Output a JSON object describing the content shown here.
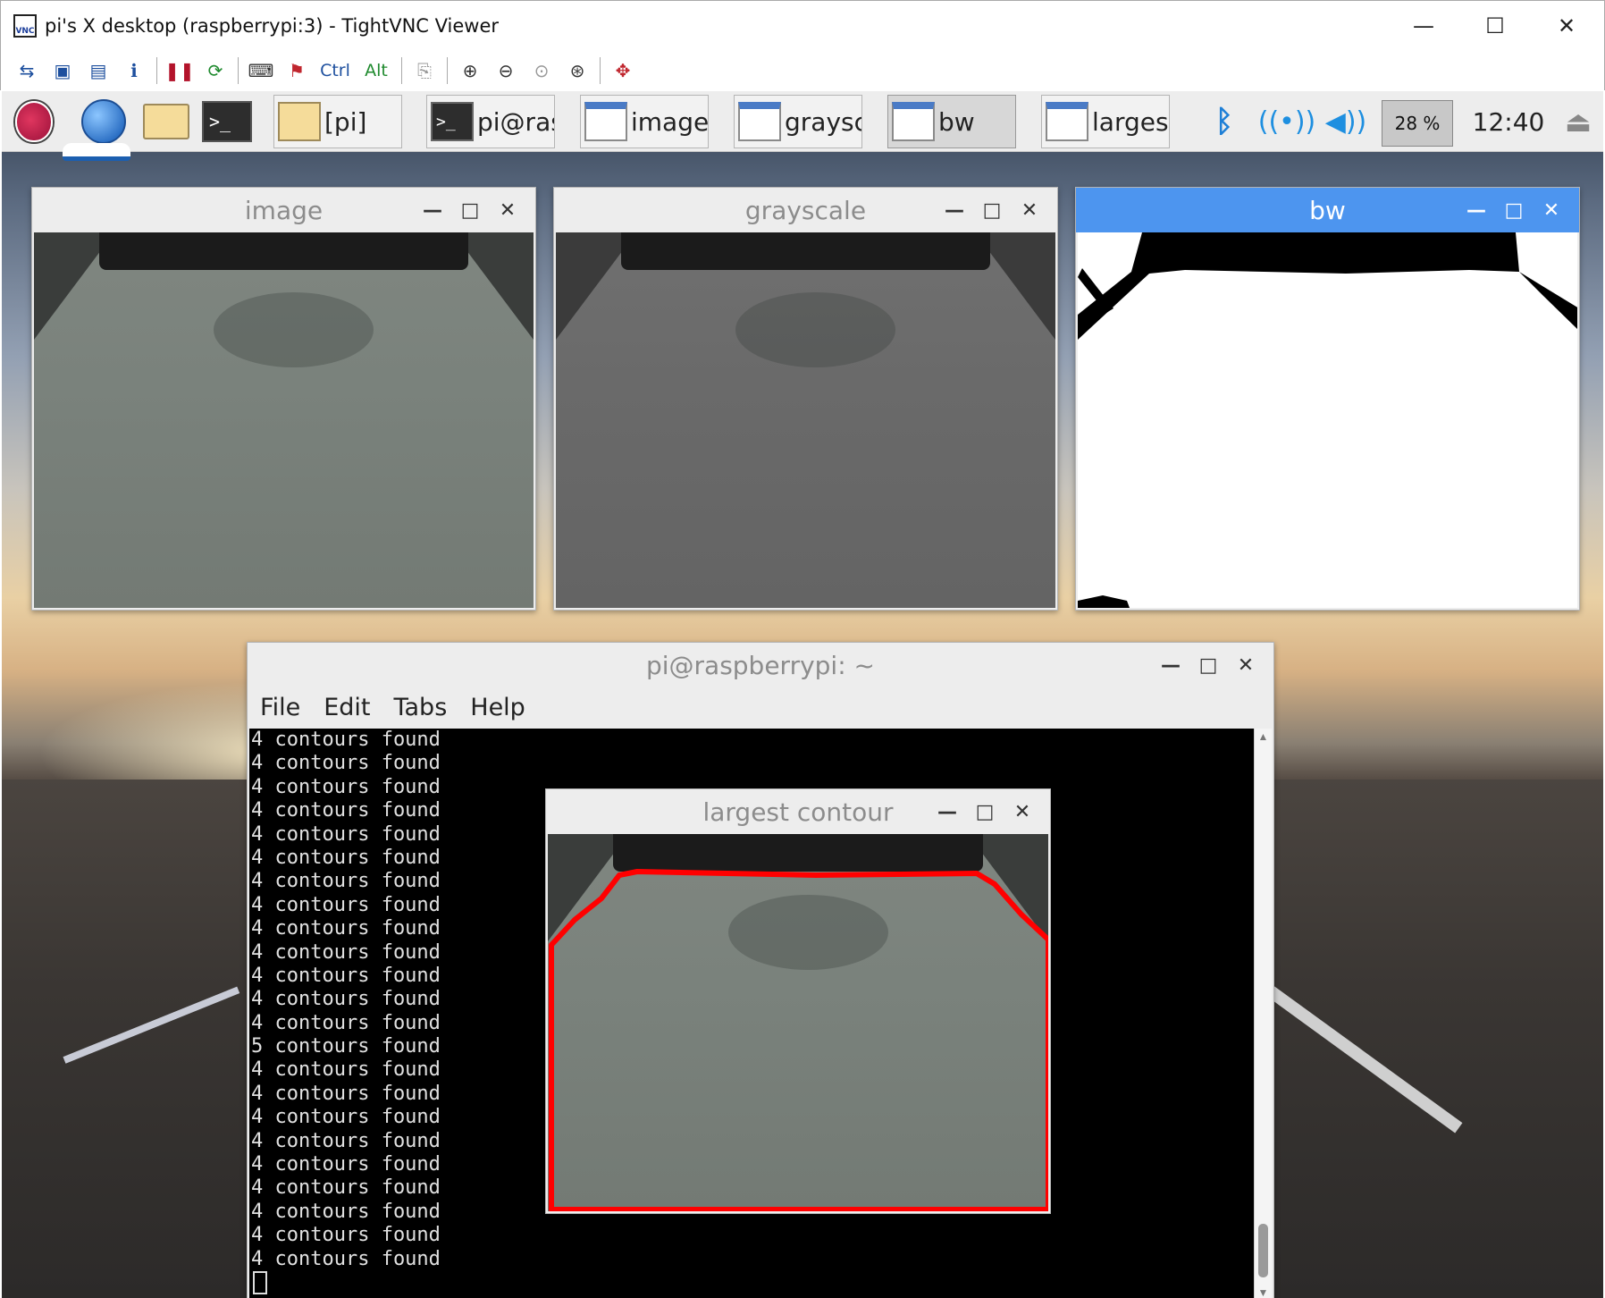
{
  "vnc": {
    "title": "pi's X desktop (raspberrypi:3) - TightVNC Viewer",
    "icon_text": "VNC",
    "controls": {
      "minimize": "—",
      "maximize": "☐",
      "close": "✕"
    },
    "toolbar": {
      "ctrl_label": "Ctrl",
      "alt_label": "Alt",
      "icons": [
        "new-connection-icon",
        "save-icon",
        "options-icon",
        "info-icon",
        "pause-icon",
        "refresh-icon",
        "send-ctrl-alt-del-icon",
        "ctrl-esc-icon",
        "ctrl-key-icon",
        "alt-key-icon",
        "clipboard-icon",
        "zoom-in-icon",
        "zoom-out-icon",
        "zoom-100-icon",
        "zoom-auto-icon",
        "fullscreen-icon"
      ]
    }
  },
  "panel": {
    "tasks": [
      {
        "label": "[pi]",
        "icon": "folder-icon"
      },
      {
        "label": "pi@ras...",
        "icon": "terminal-icon"
      },
      {
        "label": "image",
        "icon": "window-icon"
      },
      {
        "label": "graysc...",
        "icon": "window-icon"
      },
      {
        "label": "bw",
        "icon": "window-icon",
        "active": true
      },
      {
        "label": "largest...",
        "icon": "window-icon"
      }
    ],
    "tray": {
      "bluetooth": "ᛒ",
      "wifi": "((•))",
      "volume": "◀))",
      "cpu": "28 %",
      "clock": "12:40",
      "eject": "⏏"
    }
  },
  "windows": {
    "image": {
      "title": "image"
    },
    "grayscale": {
      "title": "grayscale"
    },
    "bw": {
      "title": "bw"
    },
    "largest": {
      "title": "largest contour"
    },
    "terminal": {
      "title": "pi@raspberrypi: ~",
      "menu": [
        "File",
        "Edit",
        "Tabs",
        "Help"
      ],
      "lines": [
        "4 contours found",
        "4 contours found",
        "4 contours found",
        "4 contours found",
        "4 contours found",
        "4 contours found",
        "4 contours found",
        "4 contours found",
        "4 contours found",
        "4 contours found",
        "4 contours found",
        "4 contours found",
        "4 contours found",
        "5 contours found",
        "4 contours found",
        "4 contours found",
        "4 contours found",
        "4 contours found",
        "4 contours found",
        "4 contours found",
        "4 contours found",
        "4 contours found",
        "4 contours found"
      ]
    },
    "controls": {
      "minimize": "—",
      "maximize": "□",
      "close": "✕"
    }
  },
  "colors": {
    "focused_title": "#4d95ef",
    "contour": "#ff0000",
    "terminal_bg": "#000000"
  }
}
